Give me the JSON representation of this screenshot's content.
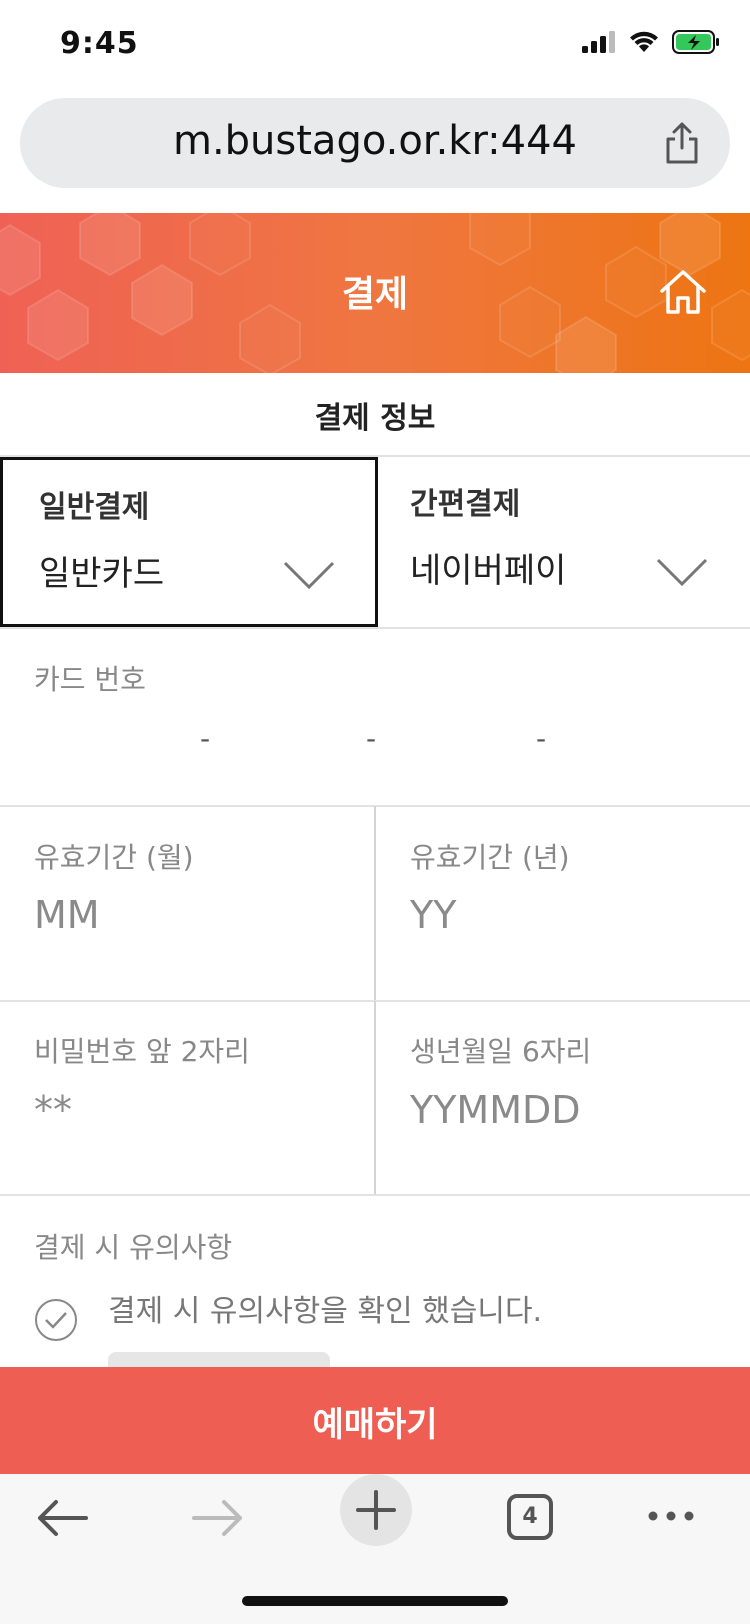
{
  "status": {
    "time": "9:45"
  },
  "browser": {
    "url": "m.bustago.or.kr:444",
    "tab_count": "4"
  },
  "header": {
    "title": "결제"
  },
  "payment": {
    "section_title": "결제 정보",
    "general": {
      "label": "일반결제",
      "value": "일반카드"
    },
    "simple": {
      "label": "간편결제",
      "value": "네이버페이"
    }
  },
  "card": {
    "number_label": "카드 번호",
    "separator": "-",
    "expiry_month_label": "유효기간 (월)",
    "expiry_month_placeholder": "MM",
    "expiry_year_label": "유효기간 (년)",
    "expiry_year_placeholder": "YY",
    "password_label": "비밀번호 앞 2자리",
    "password_placeholder": "**",
    "birth_label": "생년월일 6자리",
    "birth_placeholder": "YYMMDD"
  },
  "notice": {
    "title": "결제 시 유의사항",
    "confirm_text": "결제 시 유의사항을 확인 했습니다."
  },
  "book_button": {
    "label": "예매하기"
  },
  "colors": {
    "header_start": "#ef6155",
    "header_end": "#ee7512",
    "book_button": "#ef5e52",
    "battery": "#34c759"
  }
}
